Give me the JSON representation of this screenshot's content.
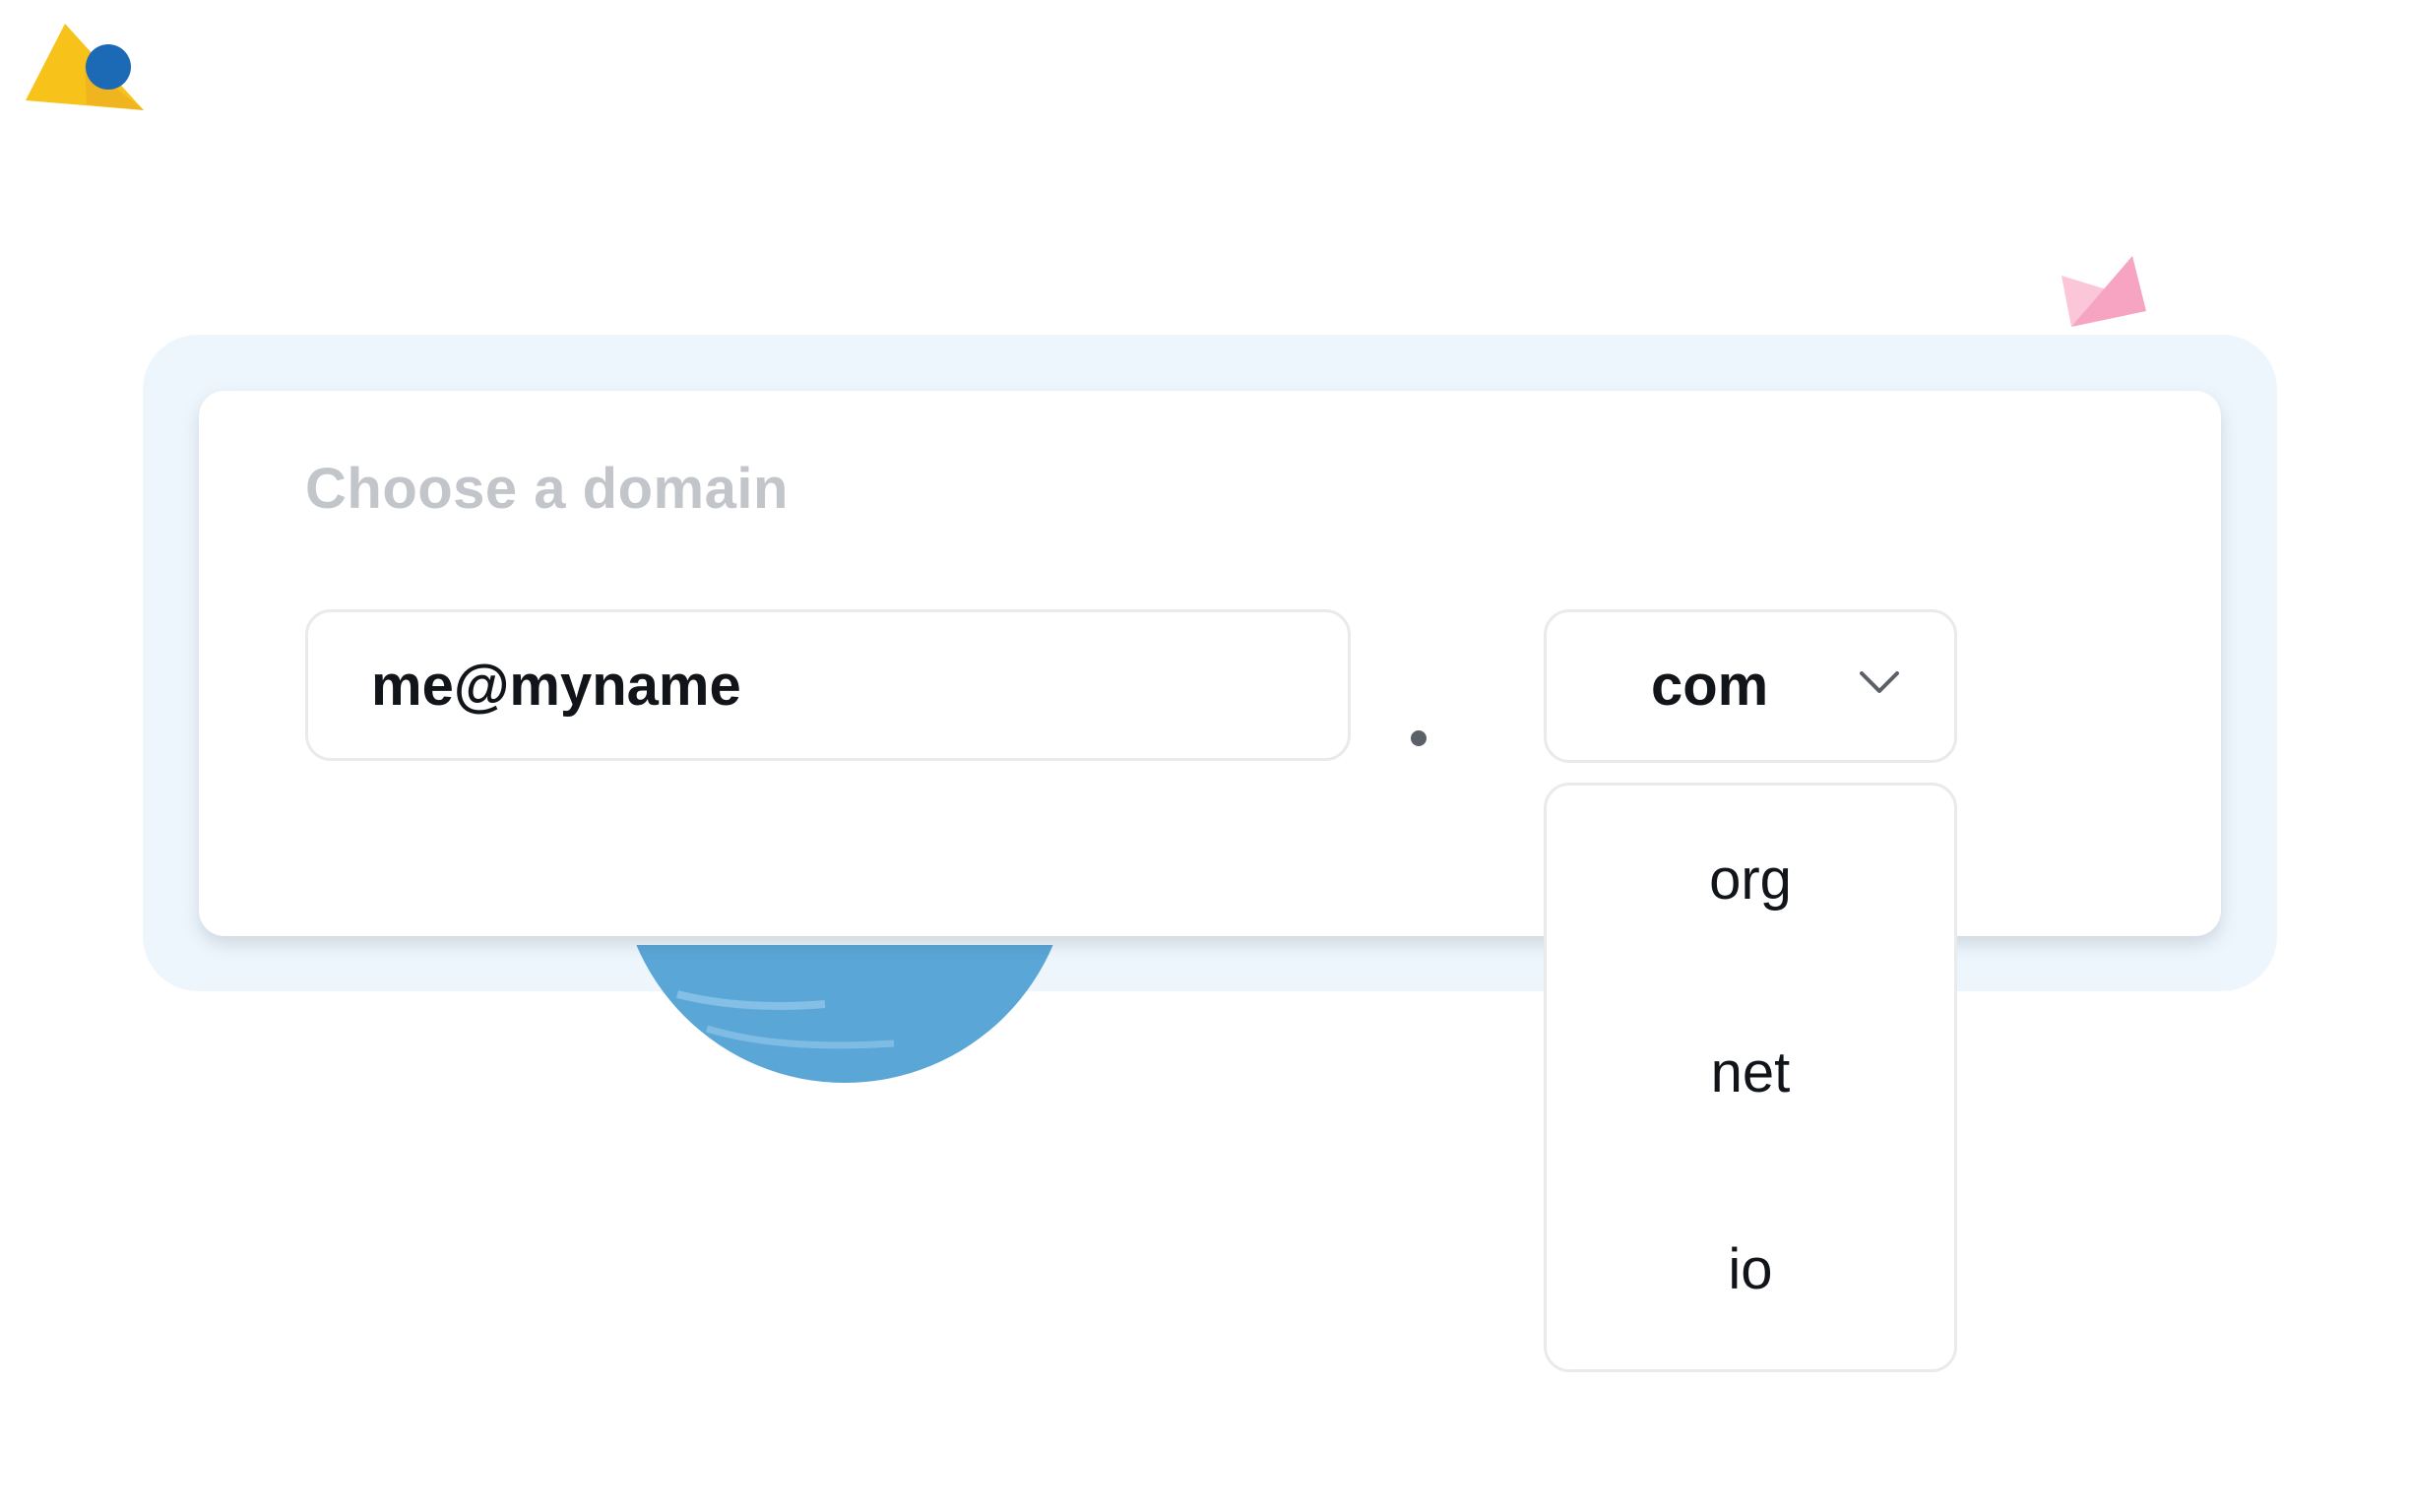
{
  "domain_form": {
    "title": "Choose a domain",
    "email_input": {
      "value": "me@myname"
    },
    "separator": ".",
    "tld_select": {
      "selected": "com",
      "expanded": true,
      "options": [
        "org",
        "net",
        "io"
      ]
    }
  },
  "icons": {
    "dropdown": "chevron-down-icon"
  },
  "colors": {
    "frame_background": "#eef6fd",
    "card_background": "#ffffff",
    "title_text": "#c2c5c9",
    "primary_text": "#111418",
    "deco_yellow": "#f7c21a",
    "deco_blue": "#1c6ab5",
    "deco_pink": "#f7a3c2",
    "globe_blue": "#5aa6d6"
  }
}
